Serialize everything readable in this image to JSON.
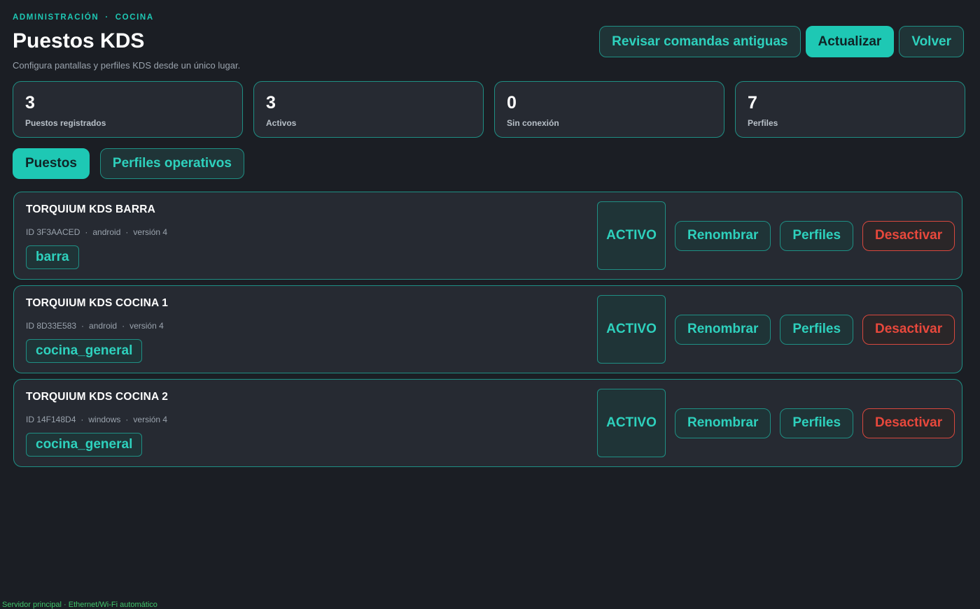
{
  "breadcrumb": {
    "section": "ADMINISTRACIÓN",
    "separator": "·",
    "current": "COCINA"
  },
  "header": {
    "title": "Puestos KDS",
    "subtitle": "Configura pantallas y perfiles KDS desde un único lugar.",
    "actions": {
      "review_label": "Revisar comandas antiguas",
      "refresh_label": "Actualizar",
      "back_label": "Volver"
    }
  },
  "stats": [
    {
      "value": "3",
      "label": "Puestos registrados"
    },
    {
      "value": "3",
      "label": "Activos"
    },
    {
      "value": "0",
      "label": "Sin conexión"
    },
    {
      "value": "7",
      "label": "Perfiles"
    }
  ],
  "tabs": [
    {
      "label": "Puestos",
      "active": true
    },
    {
      "label": "Perfiles operativos",
      "active": false
    }
  ],
  "stations": [
    {
      "name": "TORQUIUM KDS BARRA",
      "id": "ID 3F3AACED",
      "platform": "android",
      "version": "versión 4",
      "profile": "barra",
      "status": "ACTIVO",
      "rename_label": "Renombrar",
      "profiles_label": "Perfiles",
      "deactivate_label": "Desactivar"
    },
    {
      "name": "TORQUIUM KDS COCINA 1",
      "id": "ID 8D33E583",
      "platform": "android",
      "version": "versión 4",
      "profile": "cocina_general",
      "status": "ACTIVO",
      "rename_label": "Renombrar",
      "profiles_label": "Perfiles",
      "deactivate_label": "Desactivar"
    },
    {
      "name": "TORQUIUM KDS COCINA 2",
      "id": "ID 14F148D4",
      "platform": "windows",
      "version": "versión 4",
      "profile": "cocina_general",
      "status": "ACTIVO",
      "rename_label": "Renombrar",
      "profiles_label": "Perfiles",
      "deactivate_label": "Desactivar"
    }
  ],
  "meta_separator": "·",
  "footer": {
    "text": "Servidor principal · Ethernet/Wi-Fi automático"
  },
  "colors": {
    "background": "#1b1e24",
    "accent": "#1ec8b4",
    "danger": "#e8483c",
    "footer_status": "#3fc46a"
  }
}
